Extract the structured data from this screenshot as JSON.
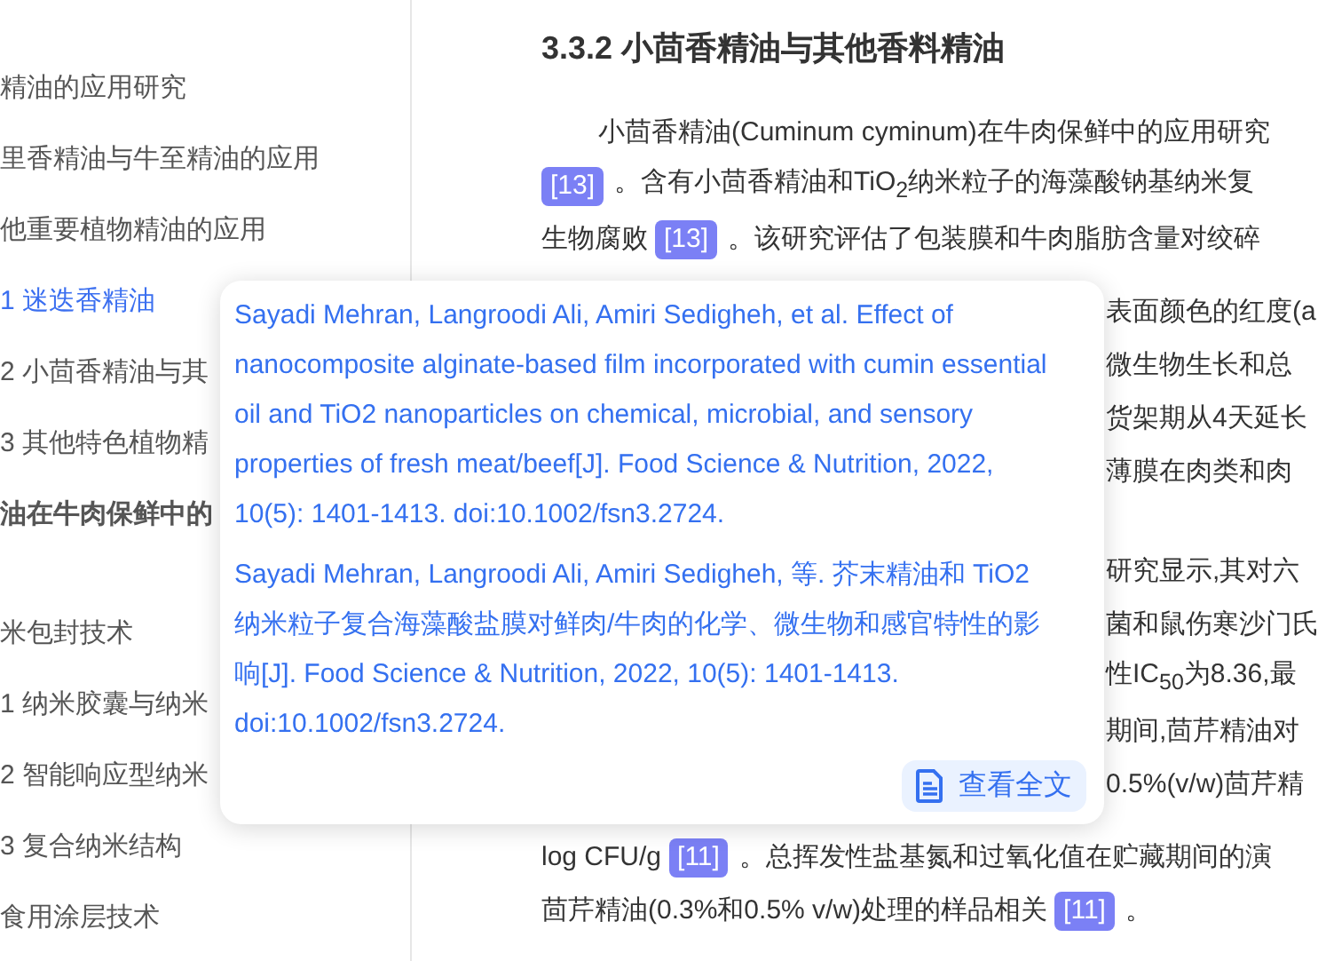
{
  "sidebar": {
    "items": [
      {
        "label": "精油的应用研究",
        "kind": "entry",
        "selected": false
      },
      {
        "label": "里香精油与牛至精油的应用",
        "kind": "entry",
        "selected": false
      },
      {
        "label": "他重要植物精油的应用",
        "kind": "entry",
        "selected": false
      },
      {
        "label": "1  迷迭香精油",
        "kind": "entry",
        "selected": true
      },
      {
        "label": "2  小茴香精油与其",
        "kind": "entry",
        "selected": false
      },
      {
        "label": "3  其他特色植物精",
        "kind": "entry",
        "selected": false
      },
      {
        "label": "油在牛肉保鲜中的",
        "kind": "heading",
        "selected": false
      },
      {
        "label": "米包封技术",
        "kind": "entry",
        "selected": false
      },
      {
        "label": "1  纳米胶囊与纳米",
        "kind": "entry",
        "selected": false
      },
      {
        "label": "2  智能响应型纳米",
        "kind": "entry",
        "selected": false
      },
      {
        "label": "3  复合纳米结构",
        "kind": "entry",
        "selected": false
      },
      {
        "label": "食用涂层技术",
        "kind": "entry",
        "selected": false
      }
    ]
  },
  "article": {
    "heading": "3.3.2 小茴香精油与其他香料精油",
    "paragraphs": [
      {
        "lines": [
          {
            "kind": "full",
            "parts": [
              {
                "kind": "text",
                "text": "小茴香精油(Cuminum cyminum)在牛肉保鲜中的应用研究"
              }
            ]
          },
          {
            "kind": "full",
            "parts": [
              {
                "kind": "cite",
                "text": "[13]"
              },
              {
                "kind": "text",
                "text": "。含有小茴香精油和TiO$_{2}$纳米粒子的海藻酸钠基纳米复"
              }
            ]
          },
          {
            "kind": "full",
            "parts": [
              {
                "kind": "text",
                "text": "生物腐败"
              },
              {
                "kind": "cite",
                "text": "[13]"
              },
              {
                "kind": "text",
                "text": "。该研究评估了包装膜和牛肉脂肪含量对绞碎"
              }
            ]
          },
          {
            "kind": "partial",
            "parts": [
              {
                "kind": "text",
                "text": "表面颜色的红度(a"
              }
            ]
          },
          {
            "kind": "partial",
            "parts": [
              {
                "kind": "text",
                "text": "微生物生长和总"
              }
            ]
          },
          {
            "kind": "partial",
            "parts": [
              {
                "kind": "text",
                "text": "货架期从4天延长"
              }
            ]
          },
          {
            "kind": "partial",
            "parts": [
              {
                "kind": "text",
                "text": "薄膜在肉类和肉"
              }
            ]
          }
        ]
      },
      {
        "lines": [
          {
            "kind": "partial",
            "parts": [
              {
                "kind": "text",
                "text": "研究显示,其对六"
              }
            ]
          },
          {
            "kind": "partial",
            "parts": [
              {
                "kind": "text",
                "text": "菌和鼠伤寒沙门氏"
              }
            ]
          },
          {
            "kind": "partial",
            "parts": [
              {
                "kind": "text",
                "text": "性IC$_{50}$为8.36,最"
              }
            ]
          },
          {
            "kind": "partial",
            "parts": [
              {
                "kind": "text",
                "text": "期间,茴芹精油对"
              }
            ]
          },
          {
            "kind": "partial",
            "parts": [
              {
                "kind": "text",
                "text": "0.5%(v/w)茴芹精"
              }
            ]
          },
          {
            "kind": "full",
            "parts": [
              {
                "kind": "text",
                "text": "log CFU/g"
              },
              {
                "kind": "cite",
                "text": "[11]"
              },
              {
                "kind": "text",
                "text": "。总挥发性盐基氮和过氧化值在贮藏期间的演"
              }
            ]
          },
          {
            "kind": "full",
            "parts": [
              {
                "kind": "text",
                "text": "茴芹精油(0.3%和0.5% v/w)处理的样品相关"
              },
              {
                "kind": "cite",
                "text": "[11]"
              },
              {
                "kind": "text",
                "text": "。"
              }
            ]
          }
        ]
      }
    ]
  },
  "popup": {
    "references": [
      "Sayadi Mehran, Langroodi Ali, Amiri Sedigheh, et al. Effect of nanocomposite alginate-based film incorporated with cumin essential oil and TiO2 nanoparticles on chemical, microbial, and sensory properties of fresh meat/beef[J]. Food Science & Nutrition, 2022, 10(5): 1401-1413. doi:10.1002/fsn3.2724.",
      "Sayadi Mehran, Langroodi Ali, Amiri Sedigheh, 等. 芥末精油和 TiO2 纳米粒子复合海藻酸盐膜对鲜肉/牛肉的化学、微生物和感官特性的影响[J]. Food Science & Nutrition, 2022, 10(5): 1401-1413. doi:10.1002/fsn3.2724."
    ],
    "button": "查看全文"
  }
}
